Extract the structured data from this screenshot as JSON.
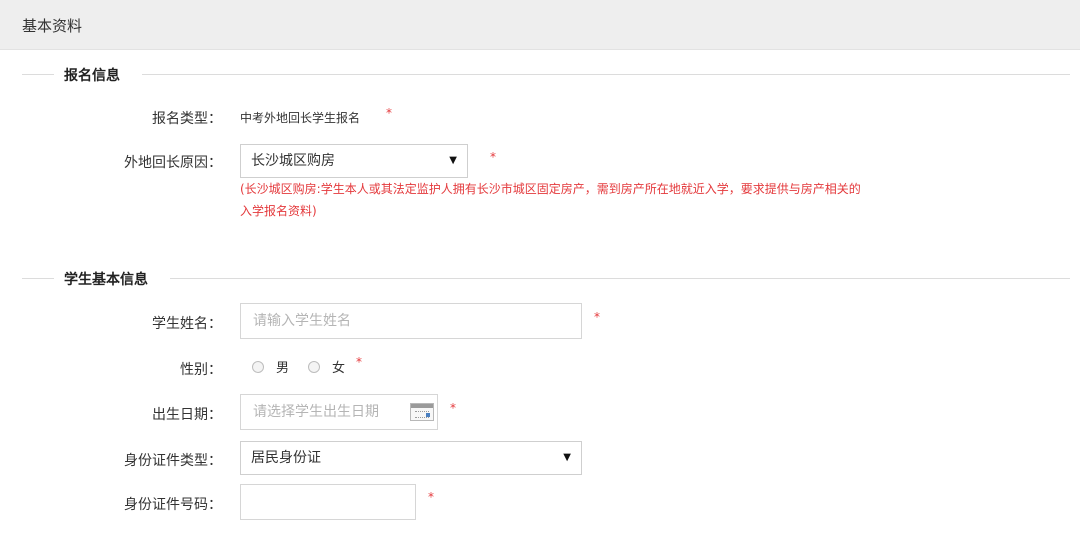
{
  "header": {
    "title": "基本资料"
  },
  "sections": {
    "registration": {
      "title": "报名信息"
    },
    "student": {
      "title": "学生基本信息"
    }
  },
  "registration": {
    "type_label": "报名类型：",
    "type_value": "中考外地回长学生报名",
    "reason_label": "外地回长原因：",
    "reason_value": "长沙城区购房",
    "reason_hint_line1": "(长沙城区购房:学生本人或其法定监护人拥有长沙市城区固定房产，需到房产所在地就近入学，要求提供与房产相关的",
    "reason_hint_line2": "入学报名资料)"
  },
  "student": {
    "name_label": "学生姓名：",
    "name_placeholder": "请输入学生姓名",
    "gender_label": "性别：",
    "gender_male": "男",
    "gender_female": "女",
    "birth_label": "出生日期：",
    "birth_placeholder": "请选择学生出生日期",
    "id_type_label": "身份证件类型：",
    "id_type_value": "居民身份证",
    "id_number_label": "身份证件号码："
  },
  "required_mark": "*",
  "dropdown_arrow": "▼",
  "icons": {
    "calendar": "calendar-icon",
    "dropdown": "chevron-down-icon"
  },
  "colors": {
    "required": "#e4393c",
    "hint": "#e4393c",
    "header_bg": "#eeeeee"
  }
}
